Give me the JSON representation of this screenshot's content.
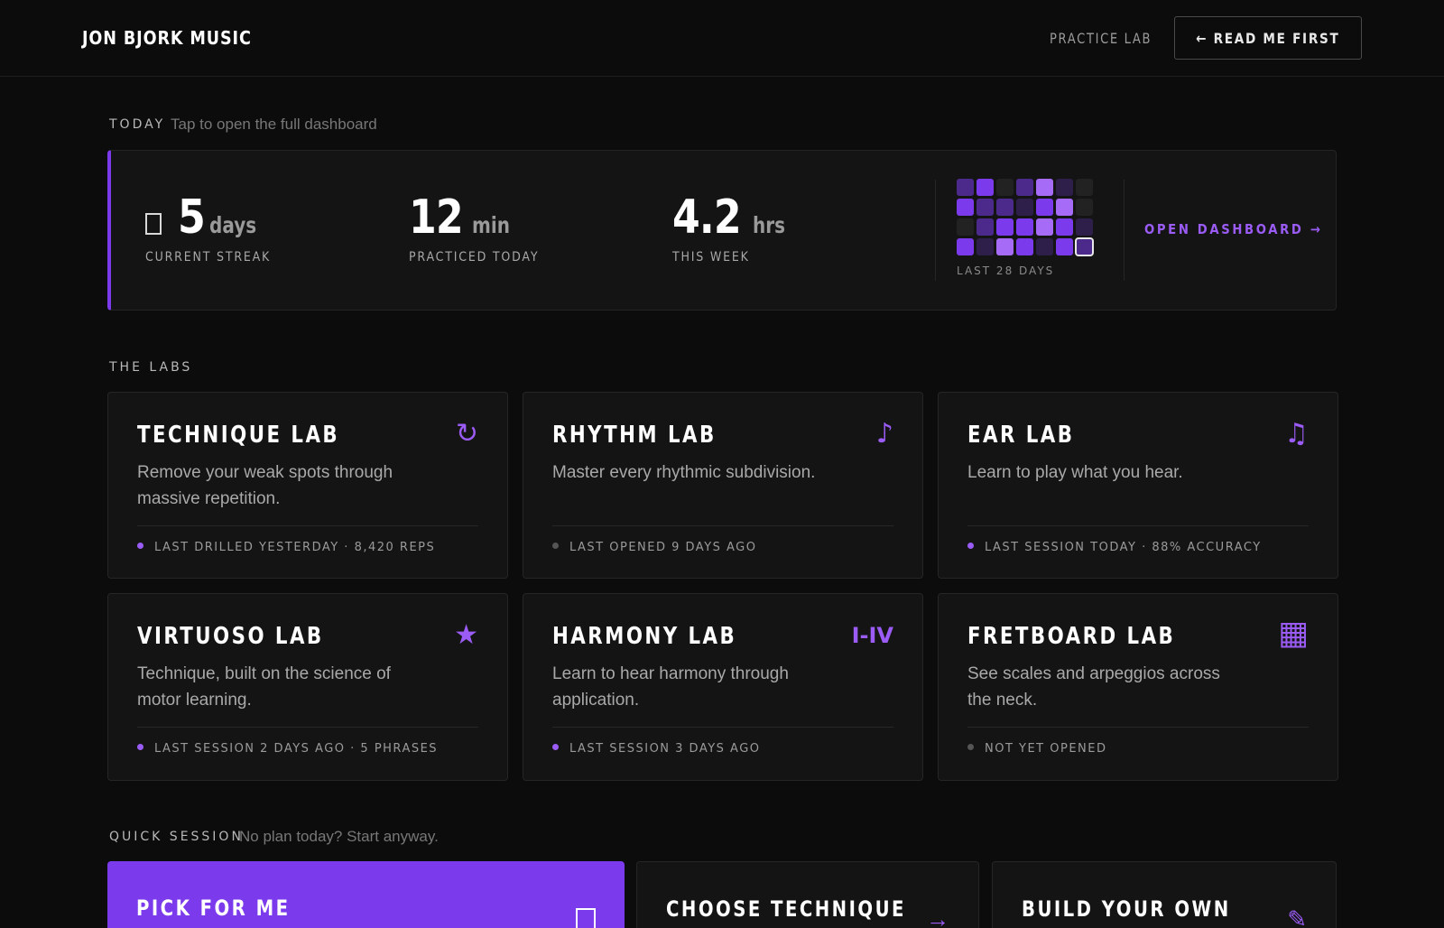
{
  "header": {
    "brand": "JON BJORK MUSIC",
    "nav_practice_lab": "PRACTICE LAB",
    "read_me_first": "← READ ME FIRST"
  },
  "today": {
    "label": "TODAY",
    "hint": "Tap to open the full dashboard",
    "streak": {
      "value": "5",
      "unit": "days",
      "caption": "CURRENT STREAK"
    },
    "practiced": {
      "value": "12",
      "unit": "min",
      "caption": "PRACTICED TODAY"
    },
    "week": {
      "value": "4.2",
      "unit": "hrs",
      "caption": "THIS WEEK"
    },
    "grid_caption": "LAST 28 DAYS",
    "grid_levels": [
      2,
      3,
      0,
      2,
      4,
      1,
      0,
      3,
      2,
      2,
      1,
      3,
      4,
      0,
      0,
      2,
      3,
      3,
      4,
      3,
      1,
      3,
      1,
      4,
      3,
      1,
      3,
      2
    ],
    "grid_colors": [
      "#222222",
      "#2e1f4a",
      "#4c2a8c",
      "#7c3aed",
      "#a66cf7"
    ],
    "open_dashboard": "OPEN DASHBOARD →",
    "accent": "#7c3aed"
  },
  "labs": {
    "label": "THE LABS",
    "cards": [
      {
        "title": "TECHNIQUE LAB",
        "icon": "repeat-icon",
        "glyph": "↻",
        "desc": "Remove your weak spots through massive repetition.",
        "meta": "LAST DRILLED YESTERDAY · 8,420 REPS",
        "active": true
      },
      {
        "title": "RHYTHM LAB",
        "icon": "music-note-icon",
        "glyph": "♪",
        "desc": "Master every rhythmic subdivision.",
        "meta": "LAST OPENED 9 DAYS AGO",
        "active": false
      },
      {
        "title": "EAR LAB",
        "icon": "beamed-notes-icon",
        "glyph": "♫",
        "desc": "Learn to play what you hear.",
        "meta": "LAST SESSION TODAY · 88% ACCURACY",
        "active": true
      },
      {
        "title": "VIRTUOSO LAB",
        "icon": "star-icon",
        "glyph": "★",
        "desc": "Technique, built on the science of motor learning.",
        "meta": "LAST SESSION 2 DAYS AGO · 5 PHRASES",
        "active": true
      },
      {
        "title": "HARMONY LAB",
        "icon": "chord-progression-icon",
        "glyph": "I-IV",
        "desc": "Learn to hear harmony through application.",
        "meta": "LAST SESSION 3 DAYS AGO",
        "active": true
      },
      {
        "title": "FRETBOARD LAB",
        "icon": "fretboard-grid-icon",
        "glyph": "▦",
        "desc": "See scales and arpeggios across the neck.",
        "meta": "NOT YET OPENED",
        "active": false
      }
    ]
  },
  "quick": {
    "label": "QUICK SESSION",
    "hint": "No plan today? Start anyway.",
    "pick_for_me": "PICK FOR ME",
    "choose_technique": "CHOOSE TECHNIQUE",
    "choose_glyph": "→",
    "build_your_own": "BUILD YOUR OWN",
    "build_glyph": "✎"
  }
}
